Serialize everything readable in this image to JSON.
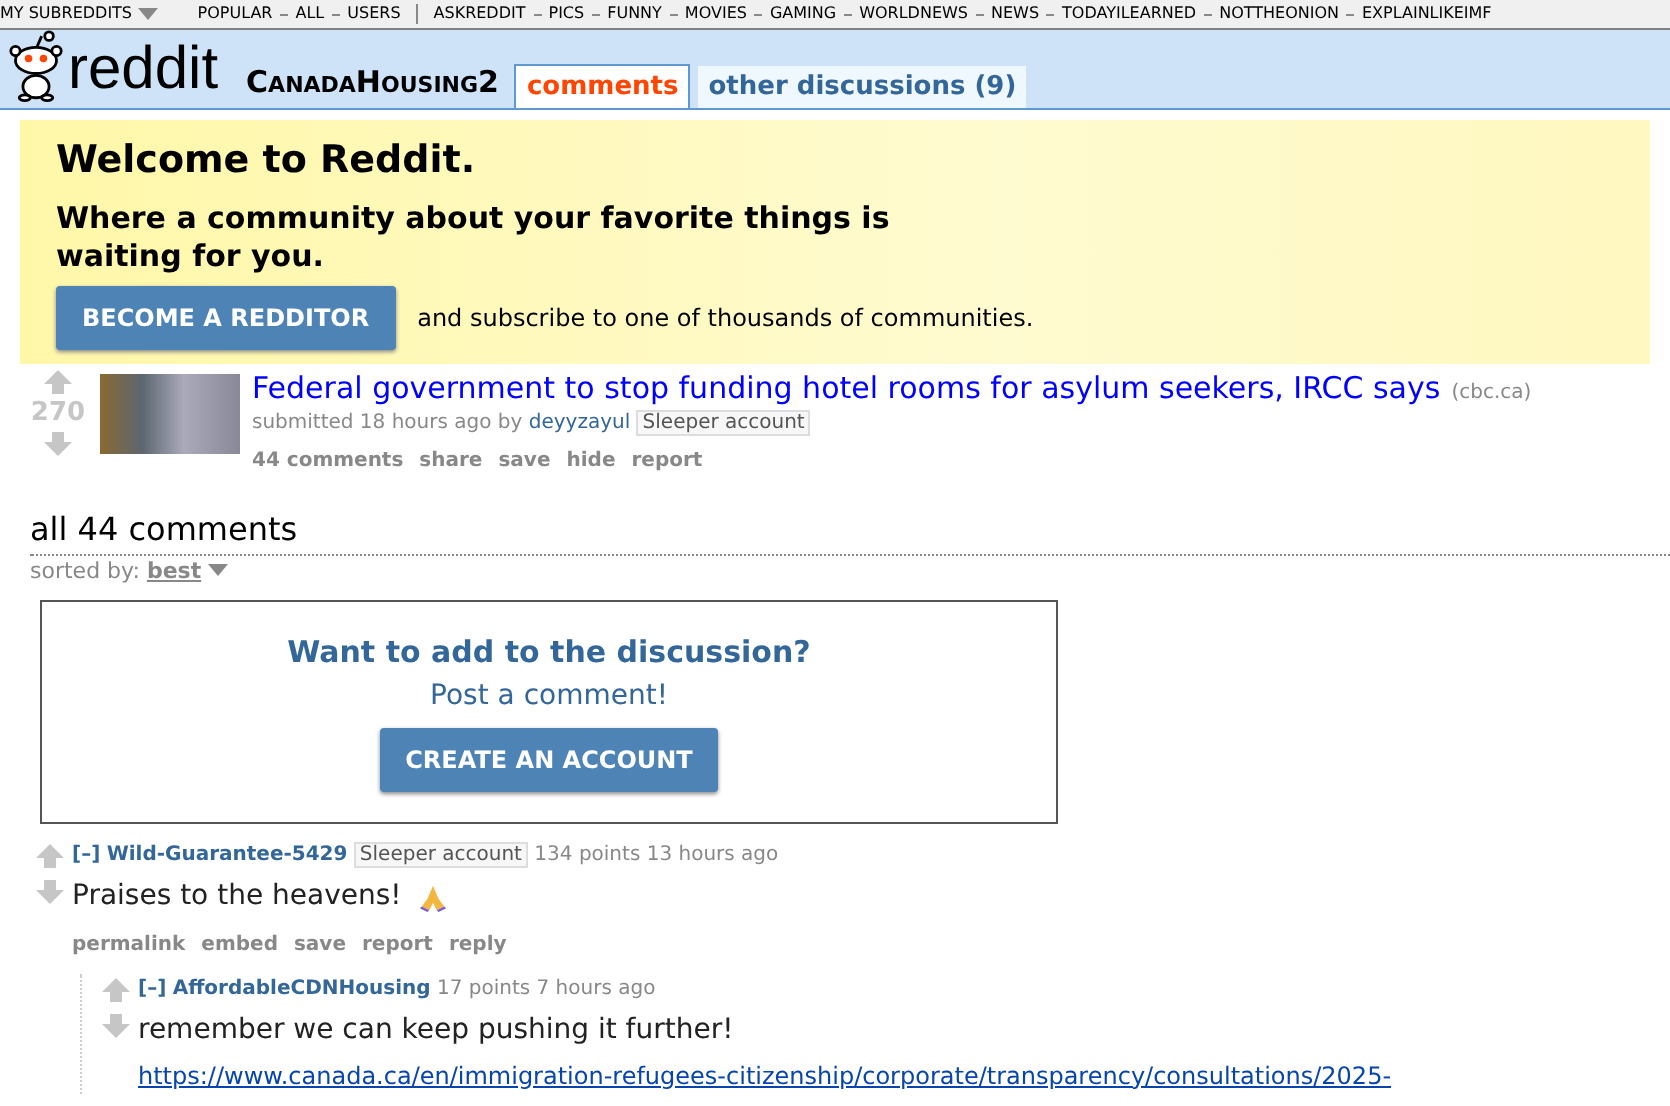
{
  "top_bar": {
    "my_subreddits": "MY SUBREDDITS",
    "groups": [
      [
        "POPULAR",
        "ALL",
        "USERS"
      ],
      [
        "ASKREDDIT",
        "PICS",
        "FUNNY",
        "MOVIES",
        "GAMING",
        "WORLDNEWS",
        "NEWS",
        "TODAYILEARNED",
        "NOTTHEONION",
        "EXPLAINLIKEIMF"
      ]
    ]
  },
  "header": {
    "logo_text": "reddit",
    "subreddit": "CanadaHousing2",
    "tabs": [
      {
        "label": "comments",
        "selected": true
      },
      {
        "label": "other discussions (9)",
        "selected": false
      }
    ]
  },
  "welcome": {
    "title": "Welcome to Reddit.",
    "subtitle": "Where a community about your favorite things is waiting for you.",
    "button": "BECOME A REDDITOR",
    "note": "and subscribe to one of thousands of communities."
  },
  "post": {
    "score": "270",
    "title": "Federal government to stop funding hotel rooms for asylum seekers, IRCC says",
    "domain": "(cbc.ca)",
    "submitted": "submitted 18 hours ago by",
    "author": "deyyzayul",
    "flair": "Sleeper account",
    "actions": [
      "44 comments",
      "share",
      "save",
      "hide",
      "report"
    ]
  },
  "comments_heading": "all 44 comments",
  "sort": {
    "label": "sorted by:",
    "value": "best"
  },
  "join_box": {
    "title": "Want to add to the discussion?",
    "subtitle": "Post a comment!",
    "button": "CREATE AN ACCOUNT"
  },
  "comments": [
    {
      "toggle": "[–]",
      "author": "Wild-Guarantee-5429",
      "flair": "Sleeper account",
      "meta": "134 points 13 hours ago",
      "body": "Praises to the heavens!",
      "emoji": true,
      "actions": [
        "permalink",
        "embed",
        "save",
        "report",
        "reply"
      ],
      "children": [
        {
          "toggle": "[–]",
          "author": "AffordableCDNHousing",
          "meta": "17 points 7 hours ago",
          "body": "remember we can keep pushing it further!",
          "link": "https://www.canada.ca/en/immigration-refugees-citizenship/corporate/transparency/consultations/2025-",
          "emoji": false
        }
      ]
    }
  ]
}
